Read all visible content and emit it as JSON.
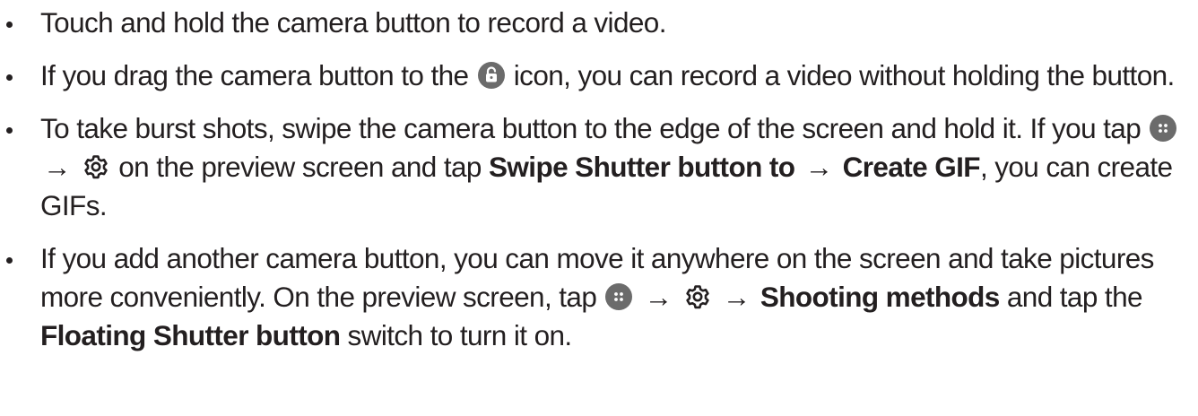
{
  "bullets": [
    {
      "text": "Touch and hold the camera button to record a video."
    },
    {
      "text_a": "If you drag the camera button to the",
      "icon": "lock-open-icon",
      "text_b": "icon, you can record a video without holding the button."
    },
    {
      "text_a": "To take burst shots, swipe the camera button to the edge of the screen and hold it. If you tap",
      "icon_1": "more-options-icon",
      "arrow_1": "→",
      "icon_2": "gear-icon",
      "text_b": "on the preview screen and tap",
      "term_1": "Swipe Shutter button to",
      "arrow_2": "→",
      "term_2": "Create GIF",
      "text_c": ", you can create GIFs."
    },
    {
      "text_a": "If you add another camera button, you can move it anywhere on the screen and take pictures more conveniently. On the preview screen, tap",
      "icon_1": "more-options-icon",
      "arrow_1": "→",
      "icon_2": "gear-icon",
      "arrow_2": "→",
      "term_1": "Shooting methods",
      "text_b": "and tap the",
      "term_2": "Floating Shutter button",
      "text_c": "switch to turn it on."
    }
  ],
  "colors": {
    "text": "#231f20",
    "icon_fill": "#6b6b6b"
  }
}
